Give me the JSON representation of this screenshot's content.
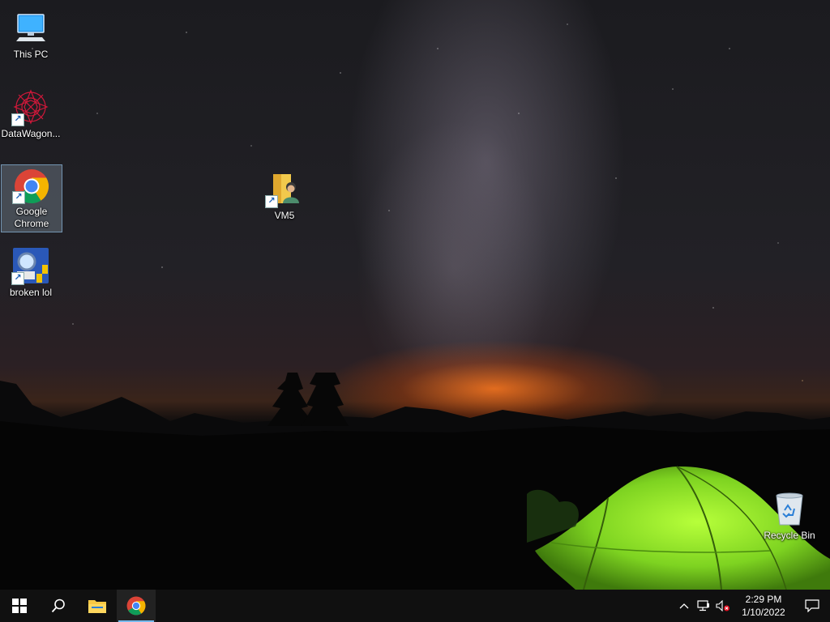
{
  "desktop": {
    "icons": [
      {
        "label": "This PC",
        "icon": "computer-icon"
      },
      {
        "label": "DataWagon...",
        "icon": "datawagon-icon",
        "shortcut": true
      },
      {
        "label": "Google Chrome",
        "icon": "chrome-icon",
        "shortcut": true,
        "selected": true
      },
      {
        "label": "broken lol",
        "icon": "broken-app-icon",
        "shortcut": true
      },
      {
        "label": "VM5",
        "icon": "user-folder-icon",
        "shortcut": true
      },
      {
        "label": "Recycle Bin",
        "icon": "recycle-bin-icon"
      }
    ]
  },
  "taskbar": {
    "start_icon": "windows-logo-icon",
    "search_icon": "search-icon",
    "pinned": [
      {
        "name": "File Explorer",
        "icon": "file-explorer-icon",
        "active": false
      },
      {
        "name": "Google Chrome",
        "icon": "chrome-icon",
        "active": true
      }
    ],
    "tray": {
      "chevron_icon": "chevron-up-icon",
      "network_icon": "network-icon",
      "volume_icon": "volume-muted-icon",
      "notification_icon": "notification-icon"
    },
    "clock": {
      "time": "2:29 PM",
      "date": "1/10/2022"
    }
  },
  "colors": {
    "taskbar_bg": "#101010",
    "active_indicator": "#76b9ed",
    "tent_green": "#8ee22a",
    "horizon_orange": "#ff7a1e"
  }
}
